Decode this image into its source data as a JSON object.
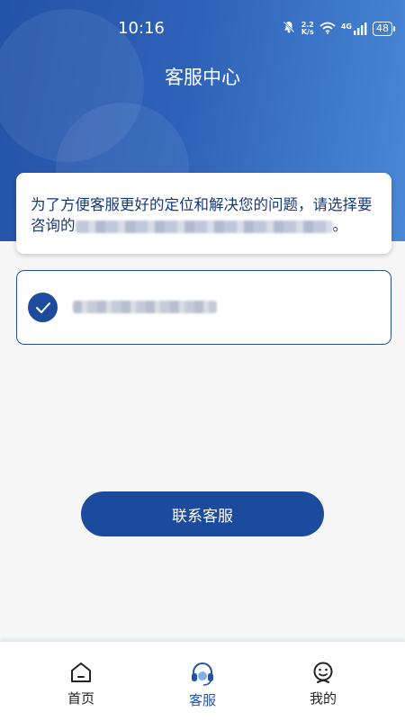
{
  "status_bar": {
    "time": "10:16",
    "net_speed_top": "2.2",
    "net_speed_bottom": "K/s",
    "signal_label": "4G",
    "battery": "48"
  },
  "header": {
    "title": "客服中心"
  },
  "notice": {
    "text_line1": "为了方便客服更好的定位和解决您的问题，请选择要咨询的",
    "text_end": "。",
    "redacted": true
  },
  "device_option": {
    "selected": true,
    "redacted": true
  },
  "contact_button": {
    "label": "联系客服"
  },
  "bottom_nav": {
    "items": [
      {
        "label": "首页",
        "icon": "home-icon",
        "active": false
      },
      {
        "label": "客服",
        "icon": "headset-icon",
        "active": true
      },
      {
        "label": "我的",
        "icon": "smile-user-icon",
        "active": false
      }
    ]
  },
  "colors": {
    "primary": "#1c4a9c",
    "header_gradient_start": "#2453a8",
    "header_gradient_end": "#4a88d6",
    "text_blue": "#173a7b",
    "background": "#f6f6f7"
  }
}
